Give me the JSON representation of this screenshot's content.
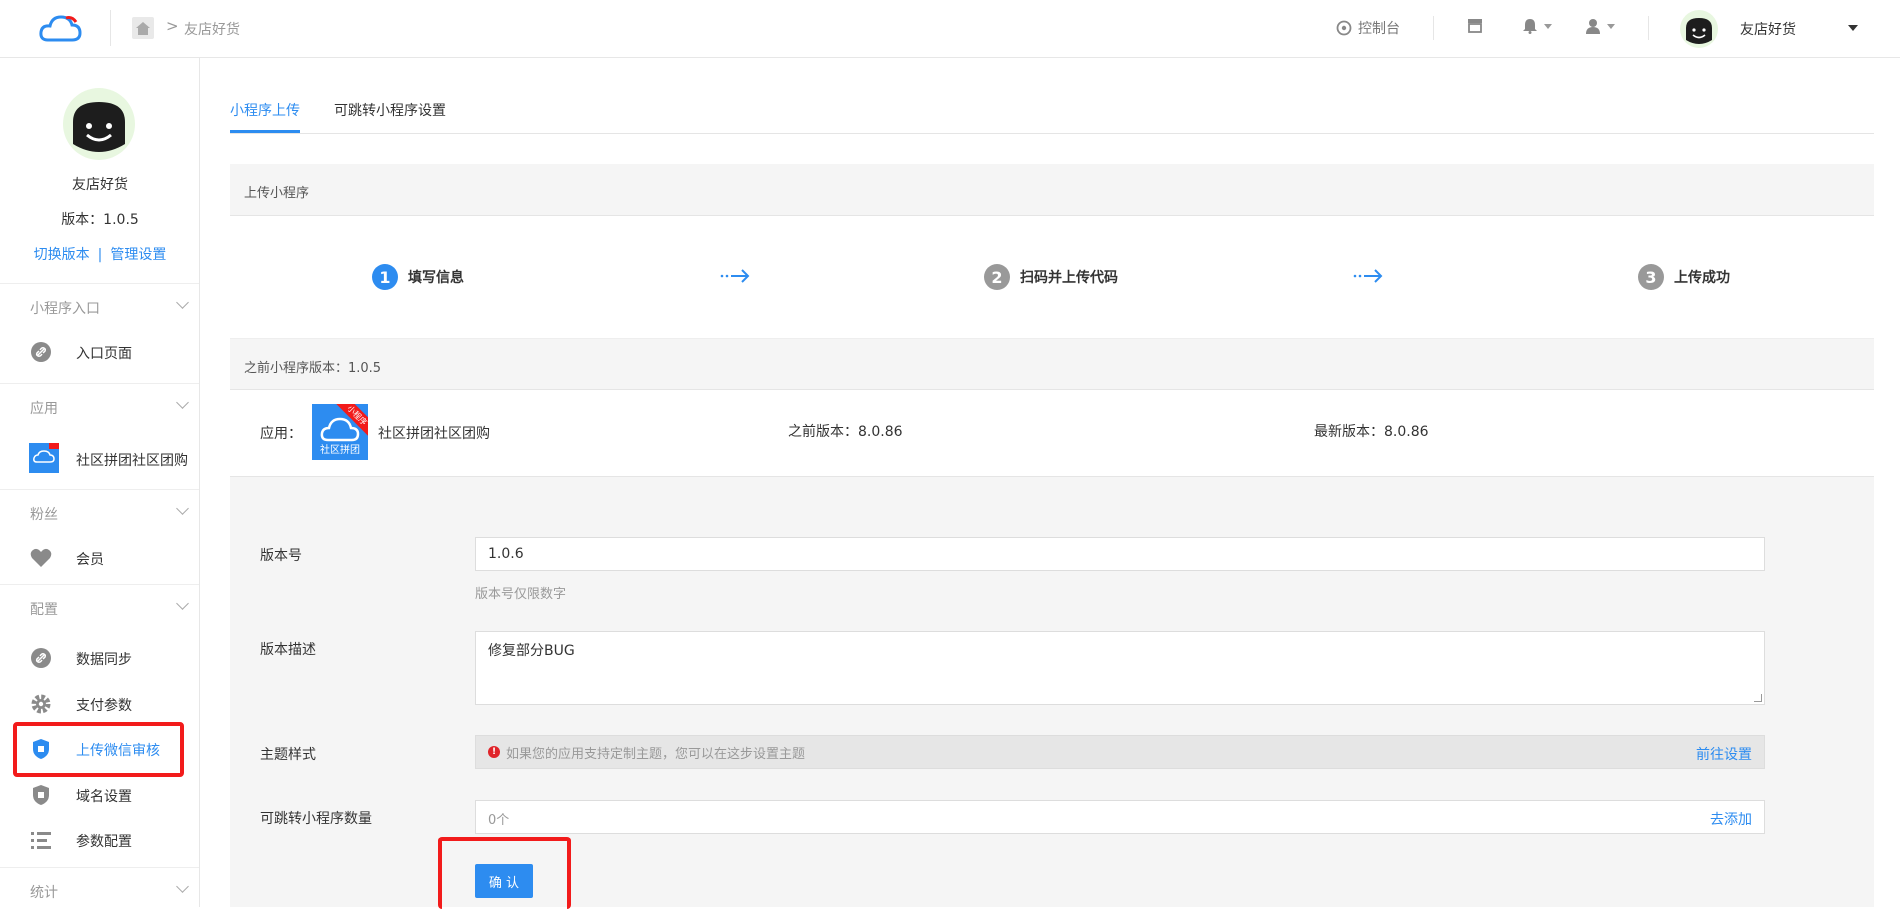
{
  "header": {
    "breadcrumb": "友店好货",
    "crumb_sep": ">",
    "console": "控制台",
    "user_name": "友店好货"
  },
  "sidebar": {
    "app_name": "友店好货",
    "version": "版本：1.0.5",
    "switch_version": "切换版本",
    "link_sep": "|",
    "manage_settings": "管理设置",
    "sections": [
      {
        "label": "小程序入口",
        "items": [
          {
            "label": "入口页面",
            "icon": "link-icon"
          }
        ]
      },
      {
        "label": "应用",
        "items": [
          {
            "label": "社区拼团社区团购",
            "icon": "app-icon"
          }
        ]
      },
      {
        "label": "粉丝",
        "items": [
          {
            "label": "会员",
            "icon": "heart-icon"
          }
        ]
      },
      {
        "label": "配置",
        "items": [
          {
            "label": "数据同步",
            "icon": "link-icon"
          },
          {
            "label": "支付参数",
            "icon": "gear-icon"
          },
          {
            "label": "上传微信审核",
            "icon": "shield-icon"
          },
          {
            "label": "域名设置",
            "icon": "shield-icon"
          },
          {
            "label": "参数配置",
            "icon": "list-icon"
          }
        ]
      },
      {
        "label": "统计",
        "items": []
      }
    ]
  },
  "tabs": [
    "小程序上传",
    "可跳转小程序设置"
  ],
  "upload": {
    "panel_title": "上传小程序",
    "steps": [
      {
        "num": "1",
        "label": "填写信息"
      },
      {
        "num": "2",
        "label": "扫码并上传代码"
      },
      {
        "num": "3",
        "label": "上传成功"
      }
    ]
  },
  "previous": {
    "panel_title": "之前小程序版本：1.0.5",
    "app_label": "应用：",
    "app_icon_caption": "社区拼团",
    "app_icon_ribbon": "小程序",
    "app_name": "社区拼团社区团购",
    "prev_version": "之前版本：8.0.86",
    "latest_version": "最新版本：8.0.86"
  },
  "form": {
    "version_label": "版本号",
    "version_value": "1.0.6",
    "version_help": "版本号仅限数字",
    "desc_label": "版本描述",
    "desc_value": "修复部分BUG",
    "theme_label": "主题样式",
    "theme_notice": "如果您的应用支持定制主题，您可以在这步设置主题",
    "theme_link": "前往设置",
    "jump_label": "可跳转小程序数量",
    "jump_value": "0个",
    "jump_link": "去添加",
    "confirm": "确 认"
  }
}
